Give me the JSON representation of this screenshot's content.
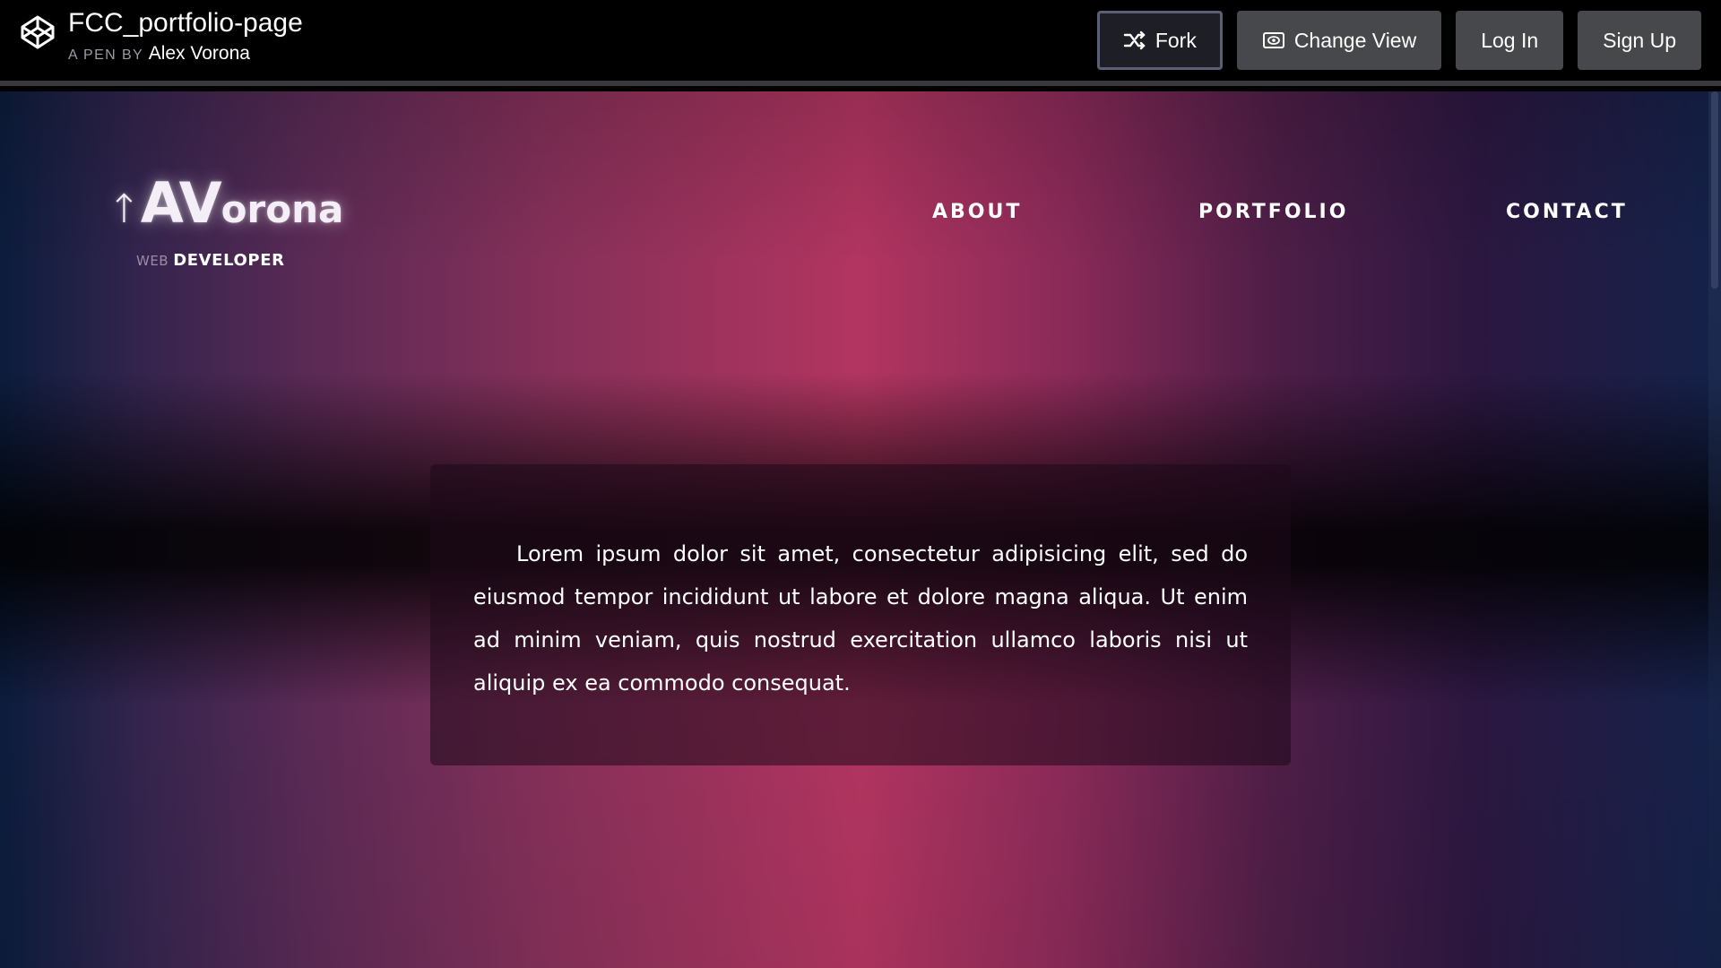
{
  "codepen": {
    "pen_title": "FCC_portfolio-page",
    "by_label": "A PEN BY",
    "author": "Alex Vorona",
    "buttons": {
      "fork": "Fork",
      "change_view": "Change View",
      "log_in": "Log In",
      "sign_up": "Sign Up"
    },
    "icons": {
      "logo": "codepen-logo-icon",
      "fork": "fork-icon",
      "change_view": "eye-icon"
    }
  },
  "site": {
    "logo": {
      "arrow": "↑",
      "initials": "AV",
      "rest": "orona"
    },
    "tagline": {
      "prefix": "WEB",
      "main": "DEVELOPER"
    },
    "nav": [
      "ABOUT",
      "PORTFOLIO",
      "CONTACT"
    ],
    "body_text": "Lorem ipsum dolor sit amet, consectetur adipisicing elit, sed do eiusmod tempor incididunt ut labore et dolore magna aliqua. Ut enim ad minim veniam, quis nostrud exercitation ullamco laboris nisi ut aliquip ex ea commodo consequat."
  },
  "colors": {
    "topbar_bg": "#000000",
    "button_bg": "#47484c",
    "accent_center": "#b23560",
    "edge_blue": "#0b1c3c"
  }
}
